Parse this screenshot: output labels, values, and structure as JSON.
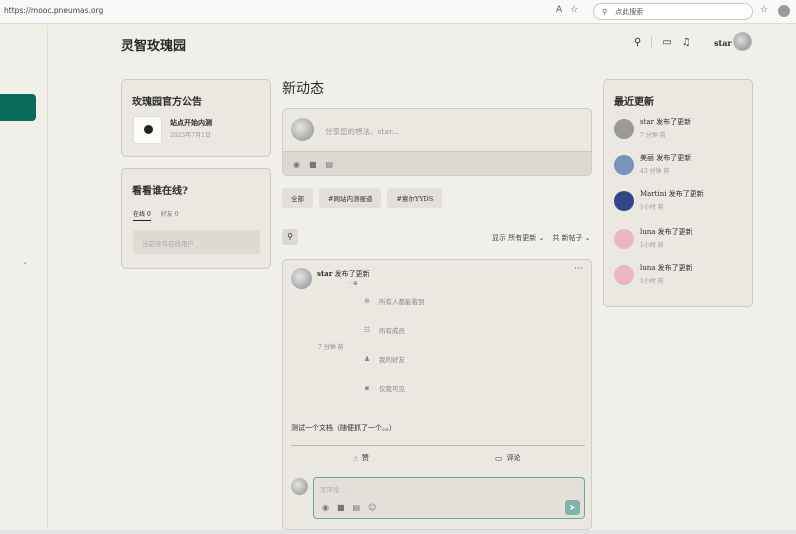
{
  "browser": {
    "url": "https://mooc.pneumas.org",
    "search_placeholder": "点此搜索",
    "icons": [
      "read-aloud-icon",
      "favorite-star-icon",
      "search-icon",
      "favorites-icon",
      "profile-icon"
    ]
  },
  "header": {
    "site_title": "灵智玫瑰园",
    "user_name": "star",
    "icons": [
      "search-icon",
      "inbox-icon",
      "bell-icon"
    ]
  },
  "announcement": {
    "title": "玫瑰园官方公告",
    "item_title": "站点开始内测",
    "item_date": "2025年7月1日"
  },
  "online": {
    "title": "看看谁在线?",
    "tab_online": "在线",
    "tab_online_count": "0",
    "tab_friends": "好友",
    "tab_friends_count": "0",
    "empty_text": "当前没有在线用户"
  },
  "feed": {
    "title": "新动态",
    "composer_placeholder": "分享您的想法，star...",
    "filters": [
      "全部",
      "#网站内测报道",
      "#索尔YYDS"
    ],
    "sort_show": "显示 所有更新",
    "sort_total": "共 新帖子"
  },
  "post": {
    "author": "star",
    "action_text": "发布了更新",
    "time": "7 分钟 前",
    "privacy_options": [
      "所有人都能看到",
      "所有成员",
      "我的好友",
      "仅我可见"
    ],
    "body": "测试一个文档（随便抓了一个。。）",
    "like_label": "赞",
    "comment_label": "评论",
    "comment_placeholder": "写评论..."
  },
  "recent": {
    "title": "最近更新",
    "items": [
      {
        "name": "star",
        "action": "发布了更新",
        "time": "7 分钟 前",
        "color": "#9a9a9a"
      },
      {
        "name": "美丽",
        "action": "发布了更新",
        "time": "43 分钟 前",
        "color": "#7a93b8"
      },
      {
        "name": "Martini",
        "action": "发布了更新",
        "time": "1小时 前",
        "color": "#2f4a86"
      },
      {
        "name": "luna",
        "action": "发布了更新",
        "time": "1小时 前",
        "color": "#e8b7c8"
      },
      {
        "name": "luna",
        "action": "发布了更新",
        "time": "1小时 前",
        "color": "#e8b7c8"
      }
    ]
  },
  "colors": {
    "accent": "#0b6b5c",
    "background": "#f1efe9",
    "panel": "#ebe8e2"
  }
}
